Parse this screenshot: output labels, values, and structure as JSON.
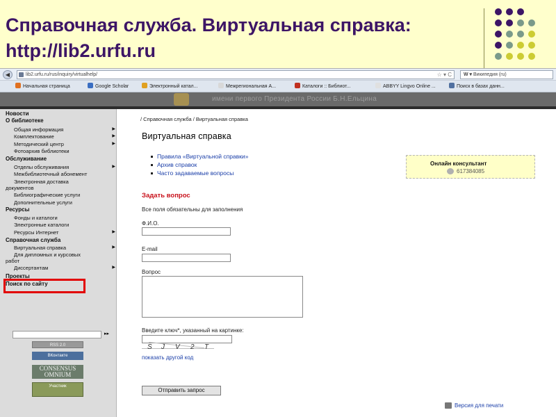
{
  "slide": {
    "title_line1": "Справочная служба. Виртуальная справка:",
    "title_line2": "http://lib2.urfu.ru",
    "accent_color": "#3d1566",
    "dot_colors": [
      "#3d1566",
      "#7a9a8a",
      "#cccc33"
    ]
  },
  "browser": {
    "url": "lib2.urfu.ru/rus/inquiry/virtualhelp/",
    "search_placeholder": "Википедия (ru)",
    "back_label": "◀",
    "bookmarks": [
      {
        "label": "Начальная страница",
        "icon": "firefox-icon",
        "color": "#e07020"
      },
      {
        "label": "Google Scholar",
        "icon": "scholar-icon",
        "color": "#3a6ec2"
      },
      {
        "label": "Электронный катал...",
        "icon": "book-icon",
        "color": "#e0a020"
      },
      {
        "label": "Межрегиональная А...",
        "icon": "page-icon",
        "color": "#d8d8d8"
      },
      {
        "label": "Каталоги :: Библиот...",
        "icon": "catalog-icon",
        "color": "#c03020"
      },
      {
        "label": "ABBYY Lingvo Online ...",
        "icon": "lingvo-icon",
        "color": "#e0e0e0"
      },
      {
        "label": "Поиск в базах данн...",
        "icon": "globe-icon",
        "color": "#5070a0"
      }
    ]
  },
  "site": {
    "banner_text": "имени первого Президента России Б.Н.Ельцина"
  },
  "sidebar": {
    "items": [
      {
        "label": "Новости",
        "kind": "sec",
        "arrow": false
      },
      {
        "label": "О библиотеке",
        "kind": "sec",
        "arrow": false
      },
      {
        "label": "Общая информация",
        "kind": "sub",
        "arrow": true
      },
      {
        "label": "Комплектование",
        "kind": "sub",
        "arrow": true
      },
      {
        "label": "Методический центр",
        "kind": "sub",
        "arrow": true
      },
      {
        "label": "Фотоархив библиотеки",
        "kind": "sub",
        "arrow": false
      },
      {
        "label": "Обслуживание",
        "kind": "sec",
        "arrow": false
      },
      {
        "label": "Отделы обслуживания",
        "kind": "sub",
        "arrow": true
      },
      {
        "label": "Межбиблиотечный абонемент",
        "kind": "sub",
        "arrow": false
      },
      {
        "label": "Электронная доставка",
        "kind": "sub",
        "arrow": false
      },
      {
        "label": "документов",
        "kind": "wrap",
        "arrow": false
      },
      {
        "label": "Библиографические услуги",
        "kind": "sub",
        "arrow": false
      },
      {
        "label": "Дополнительные услуги",
        "kind": "sub",
        "arrow": false
      },
      {
        "label": "Ресурсы",
        "kind": "sec",
        "arrow": false
      },
      {
        "label": "Фонды и каталоги",
        "kind": "sub",
        "arrow": false
      },
      {
        "label": "Электронные каталоги",
        "kind": "sub",
        "arrow": false
      },
      {
        "label": "Ресурсы Интернет",
        "kind": "sub",
        "arrow": true
      },
      {
        "label": "Справочная служба",
        "kind": "sec",
        "arrow": false
      },
      {
        "label": "Виртуальная справка",
        "kind": "sub",
        "arrow": true
      },
      {
        "label": "Для дипломных и курсовых",
        "kind": "sub",
        "arrow": false
      },
      {
        "label": "работ",
        "kind": "wrap",
        "arrow": false
      },
      {
        "label": "Диссертантам",
        "kind": "sub",
        "arrow": true
      },
      {
        "label": "Проекты",
        "kind": "sec",
        "arrow": false
      },
      {
        "label": "Поиск по сайту",
        "kind": "sec",
        "arrow": false
      }
    ],
    "search_go": "▸▸",
    "rss_label": "RSS 2.0",
    "vk_label": "ВКонтакте",
    "consensus_label": "CONSENSUS OMNIUM",
    "member_label": "Участник"
  },
  "main": {
    "breadcrumb": "/ Справочная служба / Виртуальная справка",
    "heading": "Виртуальная справка",
    "links": [
      "Правила «Виртуальной справки»",
      "Архив справок",
      "Часто задаваемые вопросы"
    ],
    "consult_title": "Онлайн консультант",
    "consult_number": "617384085",
    "ask_heading": "Задать вопрос",
    "required_note": "Все поля обязательны для заполнения",
    "fio_label": "Ф.И.О.",
    "email_label": "E-mail",
    "question_label": "Вопрос",
    "key_label": "Введите ключ*, указанный на картинке:",
    "captcha_chars": [
      "S",
      "J",
      "V",
      "2",
      "T"
    ],
    "other_code": "показать другой код",
    "submit_label": "Отправить запрос",
    "print_label": "Версия для печати"
  }
}
